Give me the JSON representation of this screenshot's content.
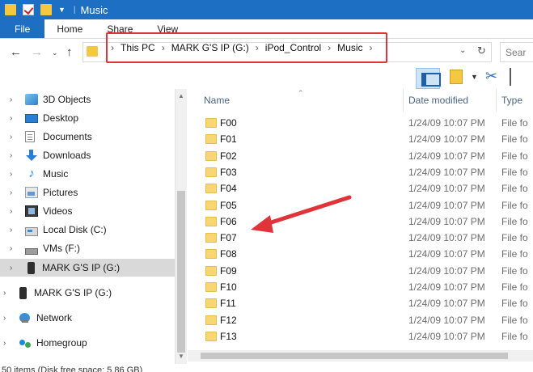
{
  "window": {
    "title": "Music"
  },
  "ribbon": {
    "tabs": [
      "File",
      "Home",
      "Share",
      "View"
    ]
  },
  "address": {
    "crumbs": [
      "This PC",
      "MARK G'S IP (G:)",
      "iPod_Control",
      "Music"
    ],
    "search_placeholder": "Sear"
  },
  "nav_pane": {
    "items": [
      {
        "label": "3D Objects",
        "icon": "3d-objects-icon"
      },
      {
        "label": "Desktop",
        "icon": "desktop-icon"
      },
      {
        "label": "Documents",
        "icon": "documents-icon"
      },
      {
        "label": "Downloads",
        "icon": "downloads-icon"
      },
      {
        "label": "Music",
        "icon": "music-icon"
      },
      {
        "label": "Pictures",
        "icon": "pictures-icon"
      },
      {
        "label": "Videos",
        "icon": "videos-icon"
      },
      {
        "label": "Local Disk (C:)",
        "icon": "local-disk-icon"
      },
      {
        "label": "VMs (F:)",
        "icon": "drive-icon"
      },
      {
        "label": "MARK G'S IP (G:)",
        "icon": "ipod-icon",
        "selected": true
      },
      {
        "label": "MARK G'S IP (G:)",
        "icon": "ipod-icon"
      },
      {
        "label": "Network",
        "icon": "network-icon"
      },
      {
        "label": "Homegroup",
        "icon": "homegroup-icon"
      }
    ]
  },
  "file_list": {
    "columns": [
      "Name",
      "Date modified",
      "Type"
    ],
    "rows": [
      {
        "name": "F00",
        "date": "1/24/09 10:07 PM",
        "type": "File fo"
      },
      {
        "name": "F01",
        "date": "1/24/09 10:07 PM",
        "type": "File fo"
      },
      {
        "name": "F02",
        "date": "1/24/09 10:07 PM",
        "type": "File fo"
      },
      {
        "name": "F03",
        "date": "1/24/09 10:07 PM",
        "type": "File fo"
      },
      {
        "name": "F04",
        "date": "1/24/09 10:07 PM",
        "type": "File fo"
      },
      {
        "name": "F05",
        "date": "1/24/09 10:07 PM",
        "type": "File fo"
      },
      {
        "name": "F06",
        "date": "1/24/09 10:07 PM",
        "type": "File fo"
      },
      {
        "name": "F07",
        "date": "1/24/09 10:07 PM",
        "type": "File fo"
      },
      {
        "name": "F08",
        "date": "1/24/09 10:07 PM",
        "type": "File fo"
      },
      {
        "name": "F09",
        "date": "1/24/09 10:07 PM",
        "type": "File fo"
      },
      {
        "name": "F10",
        "date": "1/24/09 10:07 PM",
        "type": "File fo"
      },
      {
        "name": "F11",
        "date": "1/24/09 10:07 PM",
        "type": "File fo"
      },
      {
        "name": "F12",
        "date": "1/24/09 10:07 PM",
        "type": "File fo"
      },
      {
        "name": "F13",
        "date": "1/24/09 10:07 PM",
        "type": "File fo"
      }
    ]
  },
  "status": {
    "text": "50 items (Disk free space: 5.86 GB)"
  },
  "colors": {
    "titlebar": "#1d6fc4",
    "highlight_box": "#e0343a",
    "annotation_arrow": "#e0343a"
  }
}
